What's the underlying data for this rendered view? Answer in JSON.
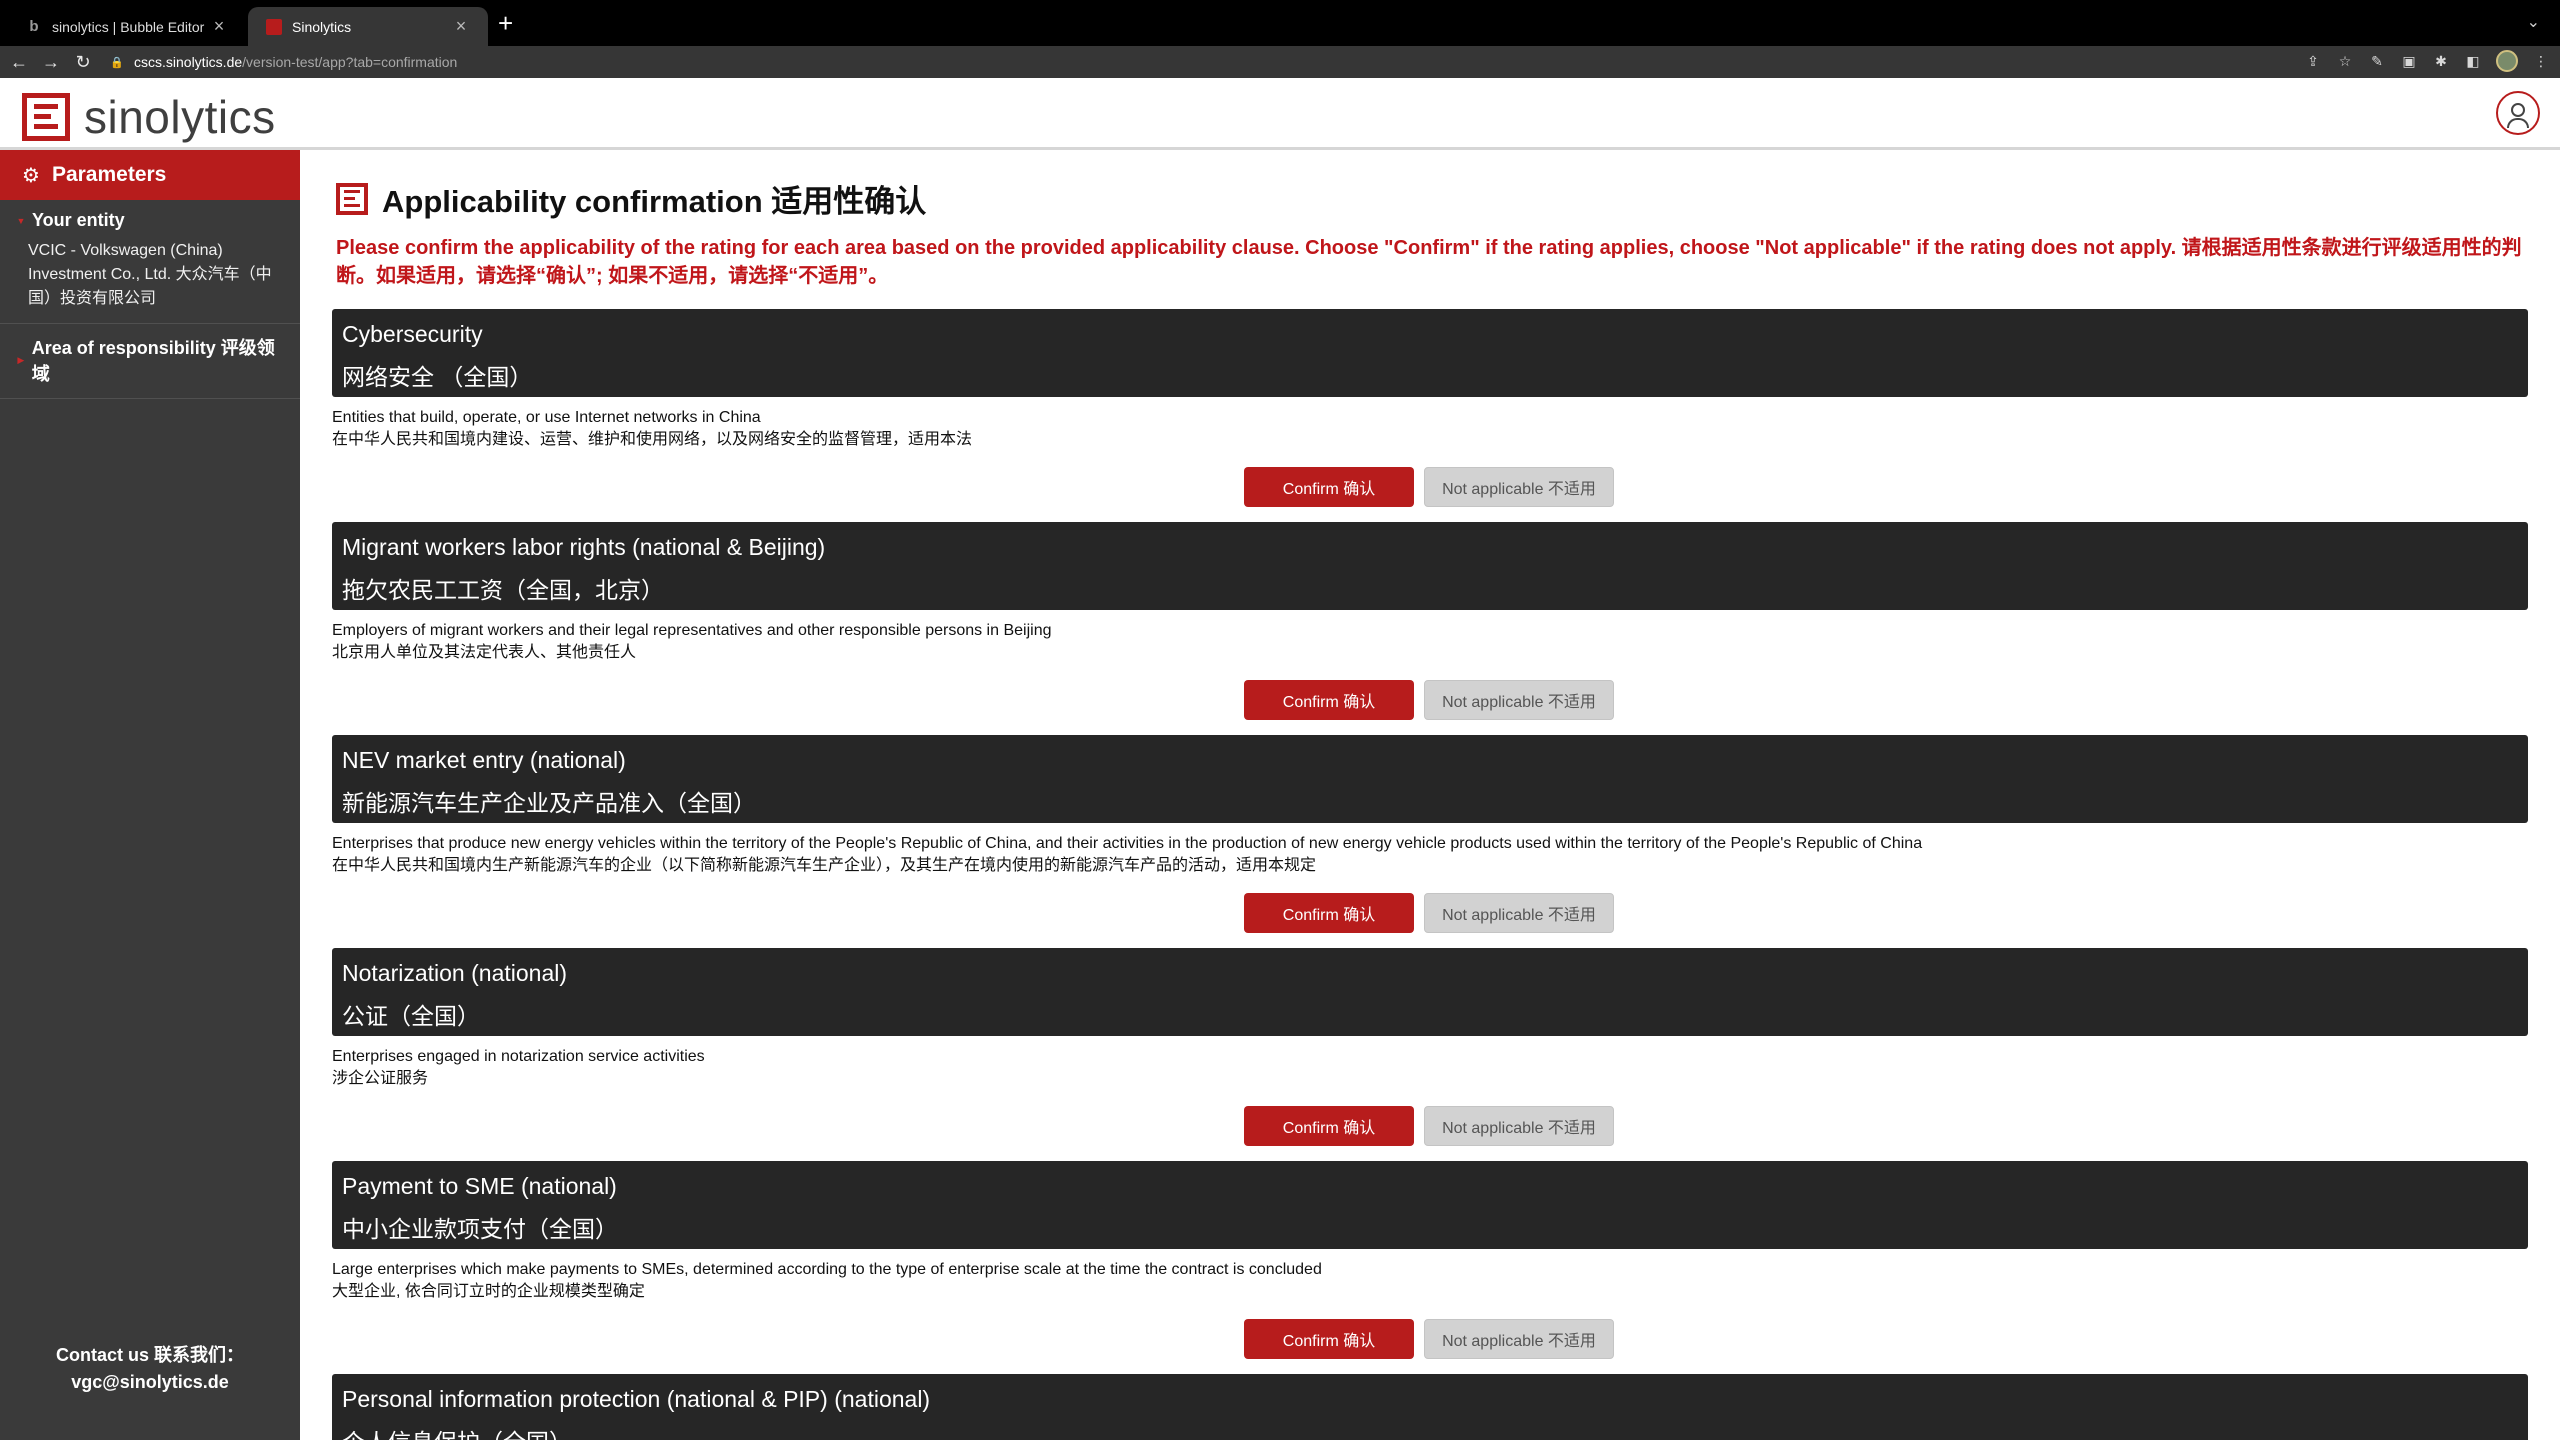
{
  "browser": {
    "tabs": [
      {
        "title": "sinolytics | Bubble Editor",
        "active": false,
        "icon": "bubble-b-icon"
      },
      {
        "title": "Sinolytics",
        "active": true,
        "icon": "sinolytics-favicon"
      }
    ],
    "url_host": "cscs.sinolytics.de",
    "url_path": "/version-test/app?tab=confirmation"
  },
  "header": {
    "logo_text": "sinolytics",
    "brand_color": "#b71c1c"
  },
  "sidebar": {
    "title": "Parameters",
    "entity_label": "Your entity",
    "entity_value": "VCIC - Volkswagen (China) Investment Co., Ltd. 大众汽车（中国）投资有限公司",
    "area_label": "Area of responsibility 评级领域",
    "contact_label": "Contact us 联系我们：",
    "contact_email": "vgc@sinolytics.de"
  },
  "main": {
    "title": "Applicability confirmation 适用性确认",
    "notice": "Please confirm the applicability of the rating for each area based on the provided applicability clause. Choose \"Confirm\" if the rating applies, choose \"Not applicable\" if the rating does not apply. 请根据适用性条款进行评级适用性的判断。如果适用，请选择“确认”; 如果不适用，请选择“不适用”。",
    "confirm_label": "Confirm 确认",
    "na_label": "Not applicable 不适用",
    "areas": [
      {
        "title_en": "Cybersecurity",
        "title_cn": "网络安全 （全国）",
        "desc_en": "Entities that build, operate, or use Internet networks in China",
        "desc_cn": "在中华人民共和国境内建设、运营、维护和使用网络，以及网络安全的监督管理，适用本法"
      },
      {
        "title_en": "Migrant workers labor rights (national & Beijing)",
        "title_cn": "拖欠农民工工资（全国，北京）",
        "desc_en": "Employers of migrant workers and their legal representatives and other responsible persons in Beijing",
        "desc_cn": "北京用人单位及其法定代表人、其他责任人"
      },
      {
        "title_en": "NEV market entry (national)",
        "title_cn": "新能源汽车生产企业及产品准入（全国）",
        "desc_en": "Enterprises that produce new energy vehicles within the territory of the People's Republic of China, and their activities in the production of new energy vehicle products used within the territory of the People's Republic of China",
        "desc_cn": "在中华人民共和国境内生产新能源汽车的企业（以下简称新能源汽车生产企业），及其生产在境内使用的新能源汽车产品的活动，适用本规定"
      },
      {
        "title_en": "Notarization (national)",
        "title_cn": "公证（全国）",
        "desc_en": "Enterprises engaged in notarization service activities",
        "desc_cn": "涉企公证服务"
      },
      {
        "title_en": "Payment to SME (national)",
        "title_cn": "中小企业款项支付（全国）",
        "desc_en": "Large enterprises which make payments to SMEs, determined according to the type of enterprise scale at the time the contract is concluded",
        "desc_cn": "大型企业, 依合同订立时的企业规模类型确定"
      },
      {
        "title_en": "Personal information protection (national & PIP) (national)",
        "title_cn": "个人信息保护（全国）",
        "desc_en": "",
        "desc_cn": ""
      }
    ]
  }
}
